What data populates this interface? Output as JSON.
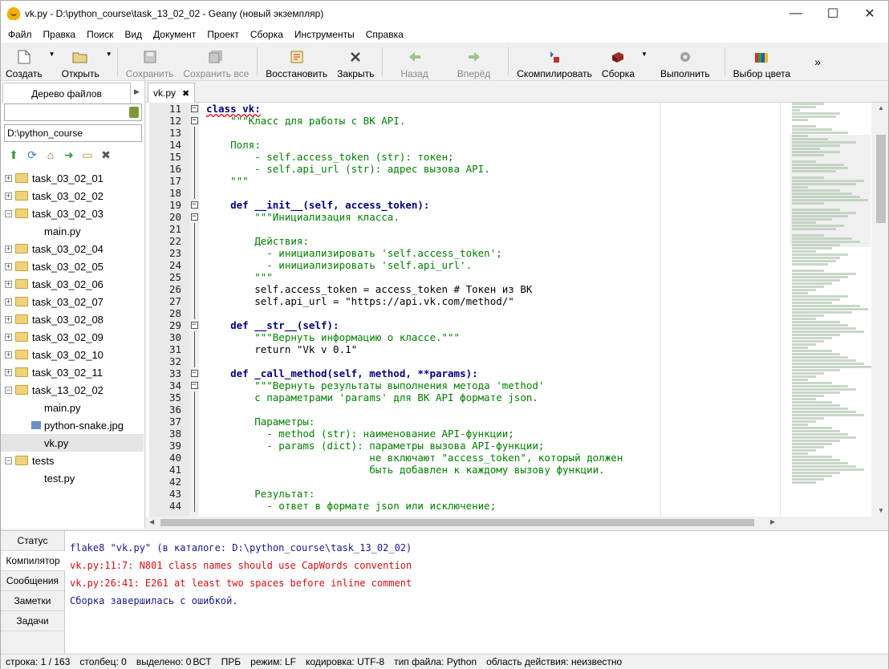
{
  "window": {
    "title": "vk.py - D:\\python_course\\task_13_02_02 - Geany (новый экземпляр)",
    "minimize": "—",
    "maximize": "☐",
    "close": "✕"
  },
  "menu": [
    "Файл",
    "Правка",
    "Поиск",
    "Вид",
    "Документ",
    "Проект",
    "Сборка",
    "Инструменты",
    "Справка"
  ],
  "toolbar": {
    "create": "Создать",
    "open": "Открыть",
    "save": "Сохранить",
    "save_all": "Сохранить все",
    "revert": "Восстановить",
    "close": "Закрыть",
    "back": "Назад",
    "forward": "Вперёд",
    "compile": "Скомпилировать",
    "build": "Сборка",
    "run": "Выполнить",
    "color": "Выбор цвета",
    "more": "»"
  },
  "sidebar": {
    "tab": "Дерево файлов",
    "path": "D:\\python_course",
    "tree": [
      {
        "label": "task_03_02_01",
        "type": "folder",
        "expanded": false
      },
      {
        "label": "task_03_02_02",
        "type": "folder",
        "expanded": false
      },
      {
        "label": "task_03_02_03",
        "type": "folder",
        "expanded": true
      },
      {
        "label": "main.py",
        "type": "file"
      },
      {
        "label": "task_03_02_04",
        "type": "folder",
        "expanded": false
      },
      {
        "label": "task_03_02_05",
        "type": "folder",
        "expanded": false
      },
      {
        "label": "task_03_02_06",
        "type": "folder",
        "expanded": false
      },
      {
        "label": "task_03_02_07",
        "type": "folder",
        "expanded": false
      },
      {
        "label": "task_03_02_08",
        "type": "folder",
        "expanded": false
      },
      {
        "label": "task_03_02_09",
        "type": "folder",
        "expanded": false
      },
      {
        "label": "task_03_02_10",
        "type": "folder",
        "expanded": false
      },
      {
        "label": "task_03_02_11",
        "type": "folder",
        "expanded": false
      },
      {
        "label": "task_13_02_02",
        "type": "folder",
        "expanded": true
      },
      {
        "label": "main.py",
        "type": "file"
      },
      {
        "label": "python-snake.jpg",
        "type": "image"
      },
      {
        "label": "vk.py",
        "type": "file",
        "selected": true
      },
      {
        "label": "tests",
        "type": "folder",
        "expanded": true
      },
      {
        "label": "test.py",
        "type": "file"
      }
    ]
  },
  "editor": {
    "tab": "vk.py",
    "lines": [
      {
        "n": "11",
        "fold": "box",
        "text": "class vk:"
      },
      {
        "n": "12",
        "fold": "box",
        "text": "    \"\"\"Класс для работы с ВК API."
      },
      {
        "n": "13",
        "fold": "line",
        "text": ""
      },
      {
        "n": "14",
        "fold": "line",
        "text": "    Поля:"
      },
      {
        "n": "15",
        "fold": "line",
        "text": "        - self.access_token (str): токен;"
      },
      {
        "n": "16",
        "fold": "line",
        "text": "        - self.api_url (str): адрес вызова API."
      },
      {
        "n": "17",
        "fold": "line",
        "text": "    \"\"\""
      },
      {
        "n": "18",
        "fold": "line",
        "text": ""
      },
      {
        "n": "19",
        "fold": "box",
        "text": "    def __init__(self, access_token):"
      },
      {
        "n": "20",
        "fold": "box",
        "text": "        \"\"\"Инициализация класса."
      },
      {
        "n": "21",
        "fold": "line",
        "text": ""
      },
      {
        "n": "22",
        "fold": "line",
        "text": "        Действия:"
      },
      {
        "n": "23",
        "fold": "line",
        "text": "          - инициализировать 'self.access_token';"
      },
      {
        "n": "24",
        "fold": "line",
        "text": "          - инициализировать 'self.api_url'."
      },
      {
        "n": "25",
        "fold": "line",
        "text": "        \"\"\""
      },
      {
        "n": "26",
        "fold": "line",
        "text": "        self.access_token = access_token # Токен из ВК"
      },
      {
        "n": "27",
        "fold": "line",
        "text": "        self.api_url = \"https://api.vk.com/method/\""
      },
      {
        "n": "28",
        "fold": "line",
        "text": ""
      },
      {
        "n": "29",
        "fold": "box",
        "text": "    def __str__(self):"
      },
      {
        "n": "30",
        "fold": "line",
        "text": "        \"\"\"Вернуть информацию о классе.\"\"\""
      },
      {
        "n": "31",
        "fold": "line",
        "text": "        return \"Vk v 0.1\""
      },
      {
        "n": "32",
        "fold": "line",
        "text": ""
      },
      {
        "n": "33",
        "fold": "box",
        "text": "    def _call_method(self, method, **params):"
      },
      {
        "n": "34",
        "fold": "box",
        "text": "        \"\"\"Вернуть результаты выполнения метода 'method'"
      },
      {
        "n": "35",
        "fold": "line",
        "text": "        с параметрами 'params' для ВК API формате json."
      },
      {
        "n": "36",
        "fold": "line",
        "text": ""
      },
      {
        "n": "37",
        "fold": "line",
        "text": "        Параметры:"
      },
      {
        "n": "38",
        "fold": "line",
        "text": "          - method (str): наименование API-функции;"
      },
      {
        "n": "39",
        "fold": "line",
        "text": "          - params (dict): параметры вызова API-функции;"
      },
      {
        "n": "40",
        "fold": "line",
        "text": "                           не включают \"access_token\", который должен"
      },
      {
        "n": "41",
        "fold": "line",
        "text": "                           быть добавлен к каждому вызову функции."
      },
      {
        "n": "42",
        "fold": "line",
        "text": ""
      },
      {
        "n": "43",
        "fold": "line",
        "text": "        Результат:"
      },
      {
        "n": "44",
        "fold": "line",
        "text": "          - ответ в формате json или исключение;"
      }
    ]
  },
  "messages": {
    "tabs": [
      "Статус",
      "Компилятор",
      "Сообщения",
      "Заметки",
      "Задачи"
    ],
    "active_tab": "Компилятор",
    "lines": [
      {
        "text": "flake8 \"vk.py\" (в каталоге: D:\\python_course\\task_13_02_02)",
        "kind": "info"
      },
      {
        "text": "vk.py:11:7: N801 class names should use CapWords convention",
        "kind": "err"
      },
      {
        "text": "vk.py:26:41: E261 at least two spaces before inline comment",
        "kind": "err"
      },
      {
        "text": "Сборка завершилась с ошибкой.",
        "kind": "info"
      }
    ]
  },
  "status": {
    "line": "строка: 1 / 163",
    "column": "столбец: 0",
    "selected": "выделено: 0",
    "ins": "ВСТ",
    "tab": "ПРБ",
    "mode": "режим: LF",
    "encoding": "кодировка: UTF-8",
    "filetype": "тип файла: Python",
    "scope": "область действия: неизвестно"
  }
}
